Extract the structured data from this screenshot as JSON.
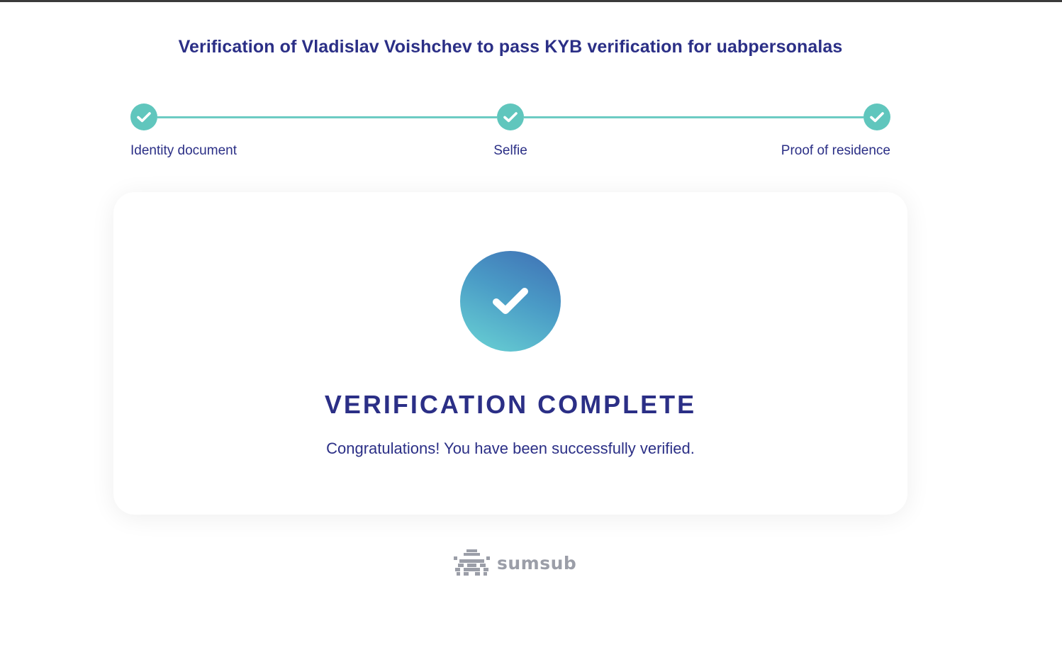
{
  "page": {
    "title": "Verification of Vladislav Voishchev to pass KYB verification for uabpersonalas"
  },
  "steps": [
    {
      "label": "Identity document",
      "status": "complete",
      "icon": "check-icon"
    },
    {
      "label": "Selfie",
      "status": "complete",
      "icon": "check-icon"
    },
    {
      "label": "Proof of residence",
      "status": "complete",
      "icon": "check-icon"
    }
  ],
  "result": {
    "icon": "check-circle-icon",
    "title": "VERIFICATION COMPLETE",
    "message": "Congratulations! You have been successfully verified."
  },
  "footer": {
    "brand": "sumsub",
    "icon": "sumsub-logo-icon"
  },
  "colors": {
    "primary_text": "#2b2f86",
    "step_accent": "#60c6bd",
    "gradient_start": "#6ad4d4",
    "gradient_end": "#3f6fb4",
    "footer_text": "#9b9ea8"
  }
}
